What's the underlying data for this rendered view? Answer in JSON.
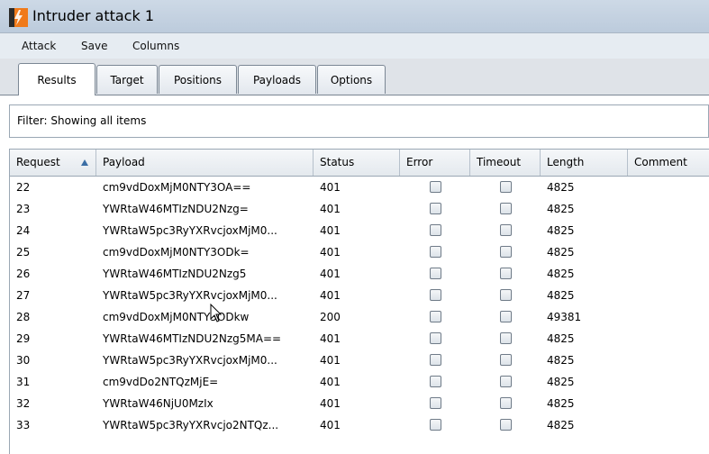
{
  "window": {
    "title": "Intruder attack 1",
    "icon": "burp-flame-icon"
  },
  "menu": [
    "Attack",
    "Save",
    "Columns"
  ],
  "tabs": [
    "Results",
    "Target",
    "Positions",
    "Payloads",
    "Options"
  ],
  "active_tab": "Results",
  "filter": {
    "text": "Filter: Showing all items"
  },
  "table": {
    "columns": [
      "Request",
      "Payload",
      "Status",
      "Error",
      "Timeout",
      "Length",
      "Comment"
    ],
    "sort_column": "Request",
    "sort_direction": "ascending",
    "rows": [
      {
        "request": "22",
        "payload": "cm9vdDoxMjM0NTY3OA==",
        "status": "401",
        "error": false,
        "timeout": false,
        "length": "4825",
        "comment": ""
      },
      {
        "request": "23",
        "payload": "YWRtaW46MTIzNDU2Nzg=",
        "status": "401",
        "error": false,
        "timeout": false,
        "length": "4825",
        "comment": ""
      },
      {
        "request": "24",
        "payload": "YWRtaW5pc3RyYXRvcjoxMjM0...",
        "status": "401",
        "error": false,
        "timeout": false,
        "length": "4825",
        "comment": ""
      },
      {
        "request": "25",
        "payload": "cm9vdDoxMjM0NTY3ODk=",
        "status": "401",
        "error": false,
        "timeout": false,
        "length": "4825",
        "comment": ""
      },
      {
        "request": "26",
        "payload": "YWRtaW46MTIzNDU2Nzg5",
        "status": "401",
        "error": false,
        "timeout": false,
        "length": "4825",
        "comment": ""
      },
      {
        "request": "27",
        "payload": "YWRtaW5pc3RyYXRvcjoxMjM0...",
        "status": "401",
        "error": false,
        "timeout": false,
        "length": "4825",
        "comment": ""
      },
      {
        "request": "28",
        "payload": "cm9vdDoxMjM0NTY3ODkw",
        "status": "200",
        "error": false,
        "timeout": false,
        "length": "49381",
        "comment": ""
      },
      {
        "request": "29",
        "payload": "YWRtaW46MTIzNDU2Nzg5MA==",
        "status": "401",
        "error": false,
        "timeout": false,
        "length": "4825",
        "comment": ""
      },
      {
        "request": "30",
        "payload": "YWRtaW5pc3RyYXRvcjoxMjM0...",
        "status": "401",
        "error": false,
        "timeout": false,
        "length": "4825",
        "comment": ""
      },
      {
        "request": "31",
        "payload": "cm9vdDo2NTQzMjE=",
        "status": "401",
        "error": false,
        "timeout": false,
        "length": "4825",
        "comment": ""
      },
      {
        "request": "32",
        "payload": "YWRtaW46NjU0MzIx",
        "status": "401",
        "error": false,
        "timeout": false,
        "length": "4825",
        "comment": ""
      },
      {
        "request": "33",
        "payload": "YWRtaW5pc3RyYXRvcjo2NTQz...",
        "status": "401",
        "error": false,
        "timeout": false,
        "length": "4825",
        "comment": ""
      }
    ]
  },
  "colors": {
    "titlebar": "#c6d4e3",
    "accent": "#f07a1a",
    "sort_arrow": "#3a6ea5"
  }
}
